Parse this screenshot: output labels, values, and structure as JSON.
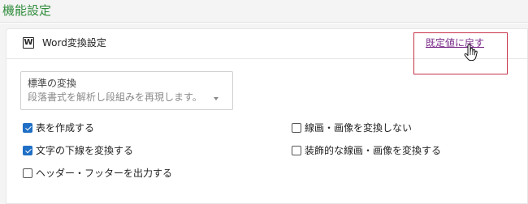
{
  "page_title": "機能設定",
  "card": {
    "title": "Word変換設定",
    "icon": "word-icon",
    "icon_glyph": "W",
    "reset_link": "既定値に戻す"
  },
  "standard_conversion": {
    "label": "標準の変換",
    "selected": "段落書式を解析し段組みを再現します。"
  },
  "options": {
    "create_table": {
      "label": "表を作成する",
      "checked": true
    },
    "convert_underline": {
      "label": "文字の下線を変換する",
      "checked": true
    },
    "output_header_footer": {
      "label": "ヘッダー・フッターを出力する",
      "checked": false
    },
    "no_convert_drawings": {
      "label": "線画・画像を変換しない",
      "checked": false
    },
    "convert_decorative_drawings": {
      "label": "装飾的な線画・画像を変換する",
      "checked": false
    }
  },
  "colors": {
    "title_green": "#2e8b3a",
    "link_purple": "#7b2c8a",
    "checkbox_blue": "#1f6fc5",
    "highlight_red": "#c8334a"
  }
}
